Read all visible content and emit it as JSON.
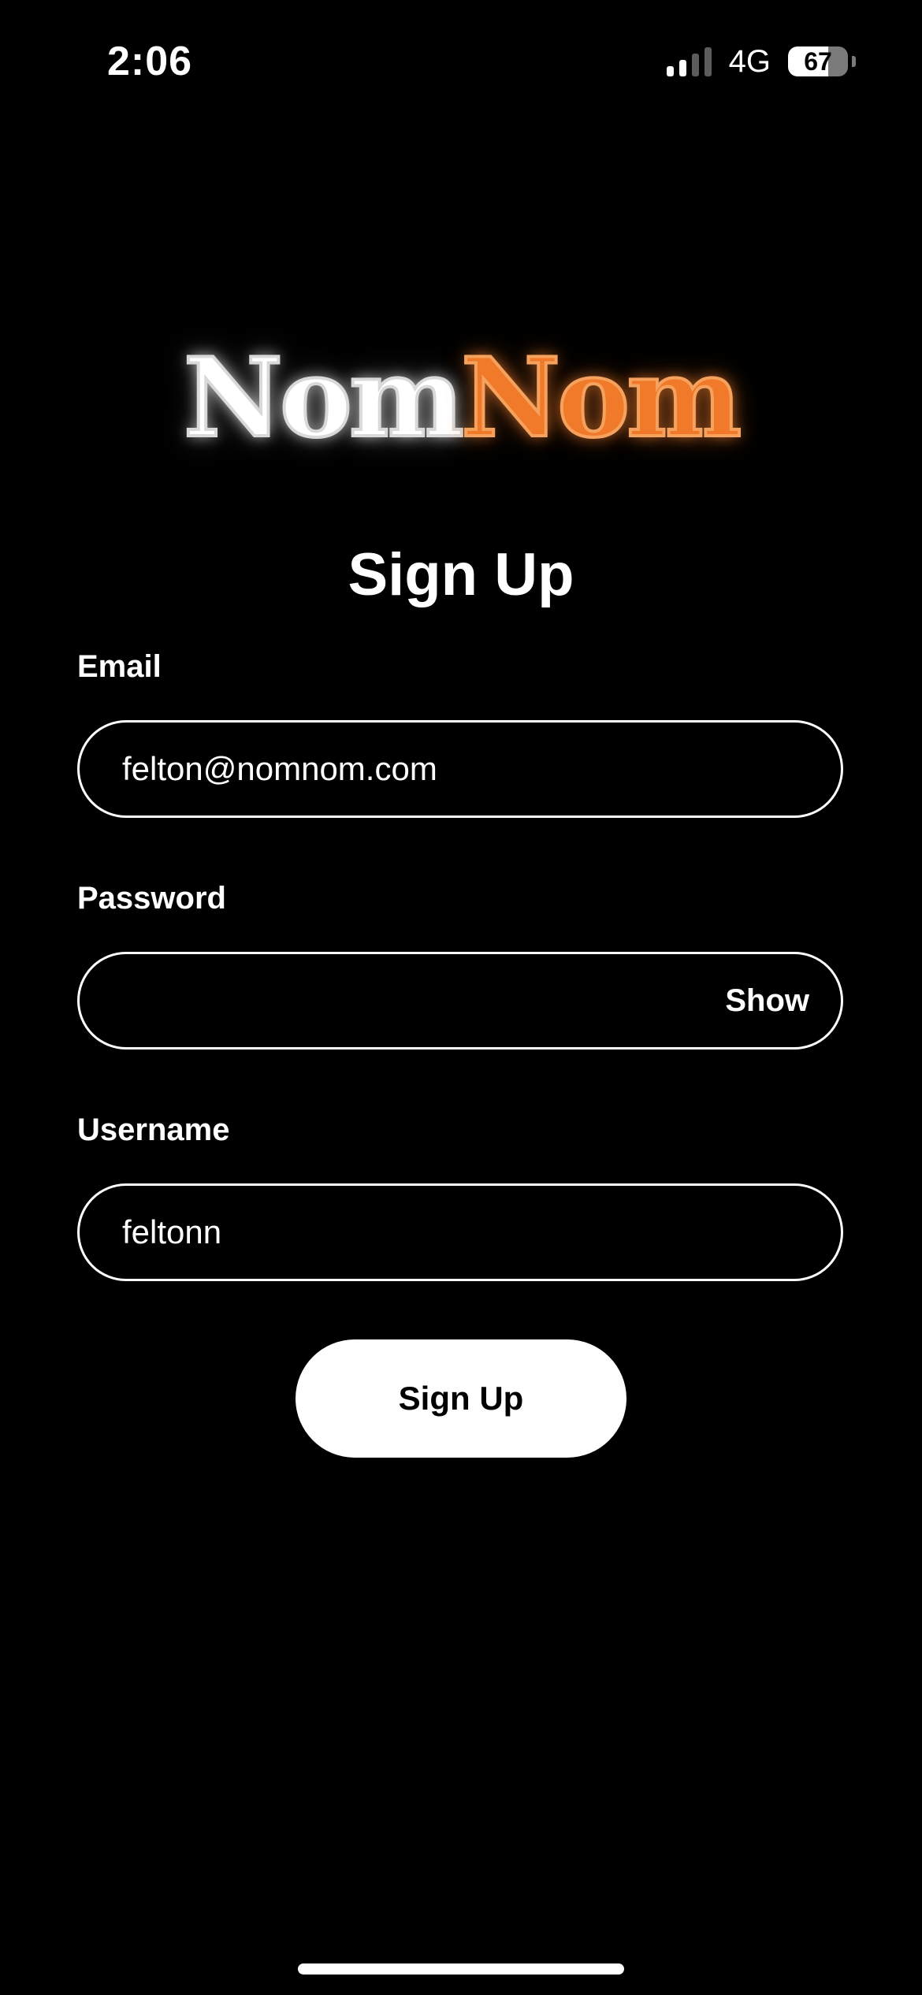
{
  "status_bar": {
    "time": "2:06",
    "network": "4G",
    "battery_level": "67",
    "battery_fraction": 0.67,
    "signal_bars_active": 2,
    "signal_bars_total": 4
  },
  "logo": {
    "part_a": "Nom",
    "part_b": "Nom",
    "colors": {
      "part_a": "#ffffff",
      "part_b": "#f07a2a"
    }
  },
  "title": "Sign Up",
  "form": {
    "email": {
      "label": "Email",
      "value": "felton@nomnom.com"
    },
    "password": {
      "label": "Password",
      "value": "",
      "toggle_label": "Show"
    },
    "username": {
      "label": "Username",
      "value": "feltonn"
    }
  },
  "submit_label": "Sign Up"
}
